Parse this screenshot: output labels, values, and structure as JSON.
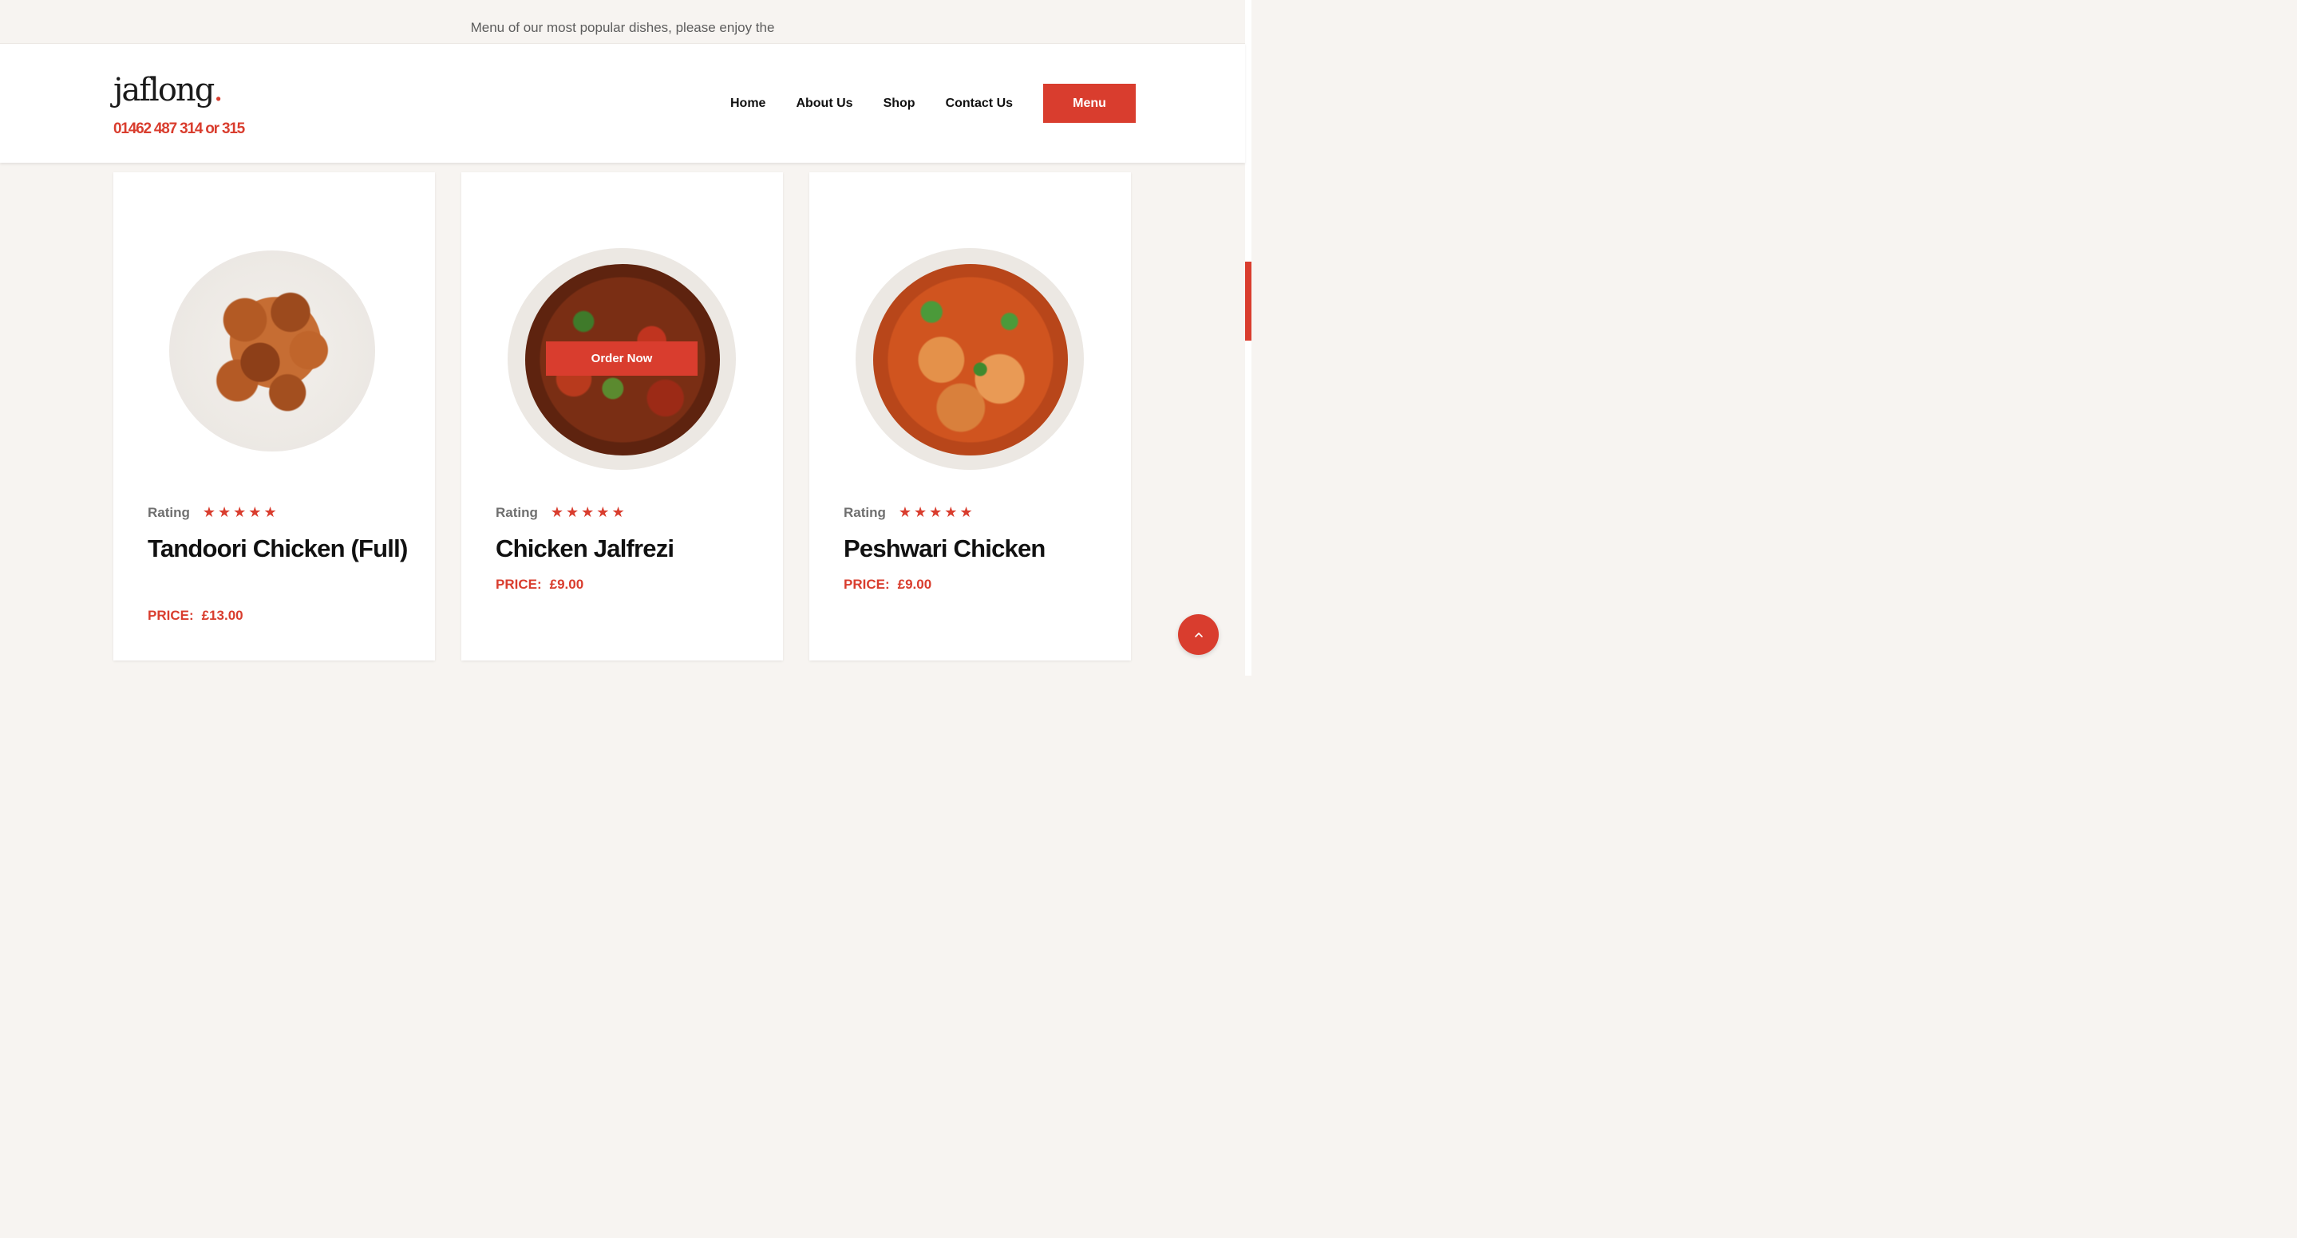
{
  "promo": {
    "text": "Menu of our most popular dishes, please enjoy the"
  },
  "header": {
    "logo_text": "jaflong",
    "logo_dot": ".",
    "phone": "01462 487 314 or 315",
    "nav": [
      {
        "label": "Home"
      },
      {
        "label": "About Us"
      },
      {
        "label": "Shop"
      },
      {
        "label": "Contact Us"
      }
    ],
    "menu_button": "Menu"
  },
  "cards": [
    {
      "rating_label": "Rating",
      "stars": "★★★★★",
      "rating_value": 5,
      "name": "Tandoori Chicken (Full)",
      "price_label": "PRICE:",
      "price": "£13.00"
    },
    {
      "rating_label": "Rating",
      "stars": "★★★★★",
      "rating_value": 5,
      "name": "Chicken Jalfrezi",
      "price_label": "PRICE:",
      "price": "£9.00",
      "order_button": "Order Now"
    },
    {
      "rating_label": "Rating",
      "stars": "★★★★★",
      "rating_value": 5,
      "name": "Peshwari Chicken",
      "price_label": "PRICE:",
      "price": "£9.00"
    }
  ],
  "icons": {
    "back_to_top": "chevron-up-icon",
    "star": "star-icon"
  },
  "colors": {
    "accent": "#d93d2e",
    "background": "#f7f4f1",
    "text": "#111111"
  }
}
